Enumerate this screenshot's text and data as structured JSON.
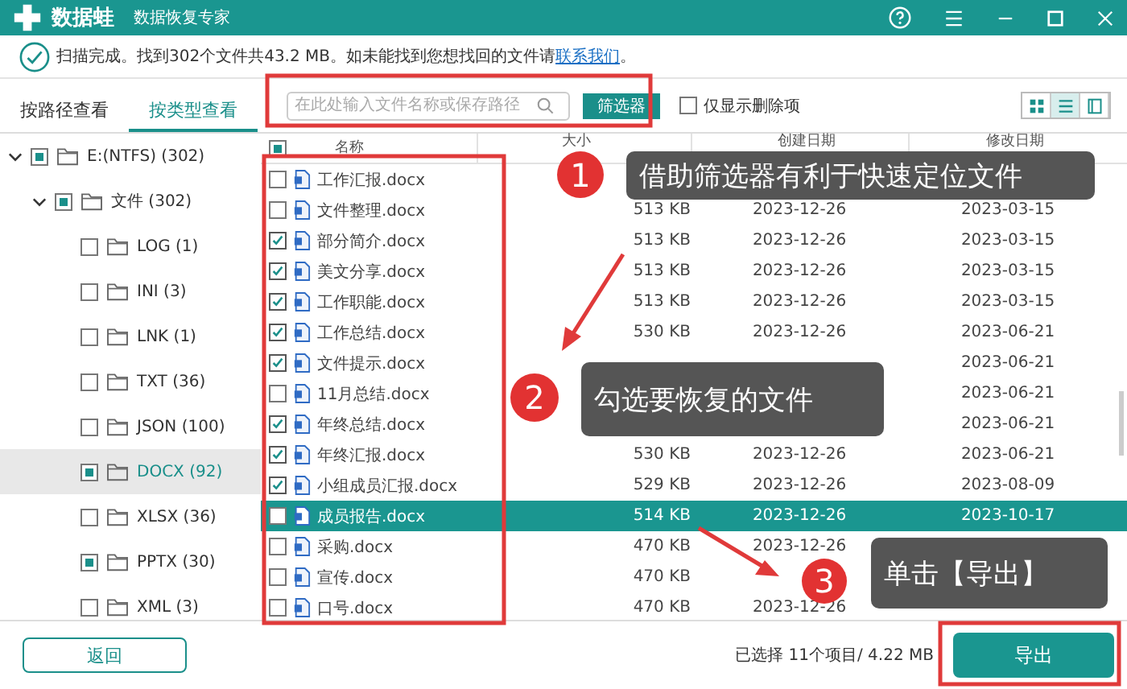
{
  "title_bar": {
    "app_name": "数据蛙",
    "subtitle": "数据恢复专家"
  },
  "scan_notice": {
    "text": "扫描完成。找到302个文件共43.2 MB。如未能找到您想找回的文件请",
    "link": "联系我们",
    "text_after": "。"
  },
  "tabs": [
    {
      "label": "按路径查看",
      "selected": false
    },
    {
      "label": "按类型查看",
      "selected": true
    }
  ],
  "search": {
    "placeholder": "在此处输入文件名称或保存路径"
  },
  "filter_button": "筛选器",
  "show_deleted_only": {
    "label": "仅显示删除项",
    "checked": false
  },
  "view_modes": [
    {
      "kind": "grid",
      "selected": false
    },
    {
      "kind": "list",
      "selected": true
    },
    {
      "kind": "panel",
      "selected": false
    }
  ],
  "tree": [
    {
      "label": "E:(NTFS) (302)",
      "partial": true,
      "expanded": true,
      "selected": false,
      "children": [
        {
          "label": "文件 (302)",
          "partial": true,
          "expanded": true,
          "selected": false,
          "children": [
            {
              "label": "LOG (1)",
              "partial": false,
              "selected": false
            },
            {
              "label": "INI (3)",
              "partial": false,
              "selected": false
            },
            {
              "label": "LNK (1)",
              "partial": false,
              "selected": false
            },
            {
              "label": "TXT (36)",
              "partial": false,
              "selected": false
            },
            {
              "label": "JSON (100)",
              "partial": false,
              "selected": false
            },
            {
              "label": "DOCX (92)",
              "partial": true,
              "selected": true
            },
            {
              "label": "XLSX (36)",
              "partial": false,
              "selected": false
            },
            {
              "label": "PPTX (30)",
              "partial": true,
              "selected": false
            },
            {
              "label": "XML (3)",
              "partial": false,
              "selected": false
            }
          ]
        }
      ]
    }
  ],
  "table": {
    "header_partial": true,
    "columns": [
      "名称",
      "大小",
      "创建日期",
      "修改日期"
    ],
    "rows": [
      {
        "name": "工作汇报.docx",
        "checked": false,
        "selected": false
      },
      {
        "name": "文件整理.docx",
        "checked": false,
        "selected": false,
        "size": "513 KB",
        "created": "2023-12-26",
        "modified": "2023-03-15"
      },
      {
        "name": "部分简介.docx",
        "checked": true,
        "selected": false,
        "size": "513 KB",
        "created": "2023-12-26",
        "modified": "2023-03-15"
      },
      {
        "name": "美文分享.docx",
        "checked": true,
        "selected": false,
        "size": "513 KB",
        "created": "2023-12-26",
        "modified": "2023-03-15"
      },
      {
        "name": "工作职能.docx",
        "checked": true,
        "selected": false,
        "size": "513 KB",
        "created": "2023-12-26",
        "modified": "2023-03-15"
      },
      {
        "name": "工作总结.docx",
        "checked": true,
        "selected": false,
        "size": "530 KB",
        "created": "2023-12-26",
        "modified": "2023-06-21"
      },
      {
        "name": "文件提示.docx",
        "checked": true,
        "selected": false,
        "modified": "2023-06-21"
      },
      {
        "name": "11月总结.docx",
        "checked": false,
        "selected": false,
        "modified": "2023-06-21"
      },
      {
        "name": "年终总结.docx",
        "checked": true,
        "selected": false,
        "modified": "2023-06-21"
      },
      {
        "name": "年终汇报.docx",
        "checked": true,
        "selected": false,
        "size": "530 KB",
        "created": "2023-12-26",
        "modified": "2023-06-21"
      },
      {
        "name": "小组成员汇报.docx",
        "checked": true,
        "selected": false,
        "size": "529 KB",
        "created": "2023-12-26",
        "modified": "2023-08-09"
      },
      {
        "name": "成员报告.docx",
        "checked": false,
        "selected": true,
        "size": "514 KB",
        "created": "2023-12-26",
        "modified": "2023-10-17"
      },
      {
        "name": "采购.docx",
        "checked": false,
        "selected": false,
        "size": "470 KB",
        "created": "2023-12-26"
      },
      {
        "name": "宣传.docx",
        "checked": false,
        "selected": false,
        "size": "470 KB"
      },
      {
        "name": "口号.docx",
        "checked": false,
        "selected": false,
        "size": "470 KB",
        "created": "2023-12-26"
      }
    ]
  },
  "footer": {
    "back_button": "返回",
    "selection_summary": "已选择 11个项目/ 4.22 MB",
    "export_button": "导出"
  },
  "annotations": [
    {
      "number": "1",
      "text": "借助筛选器有利于快速定位文件"
    },
    {
      "number": "2",
      "text": "勾选要恢复的文件"
    },
    {
      "number": "3",
      "text": "单击【导出】"
    }
  ]
}
